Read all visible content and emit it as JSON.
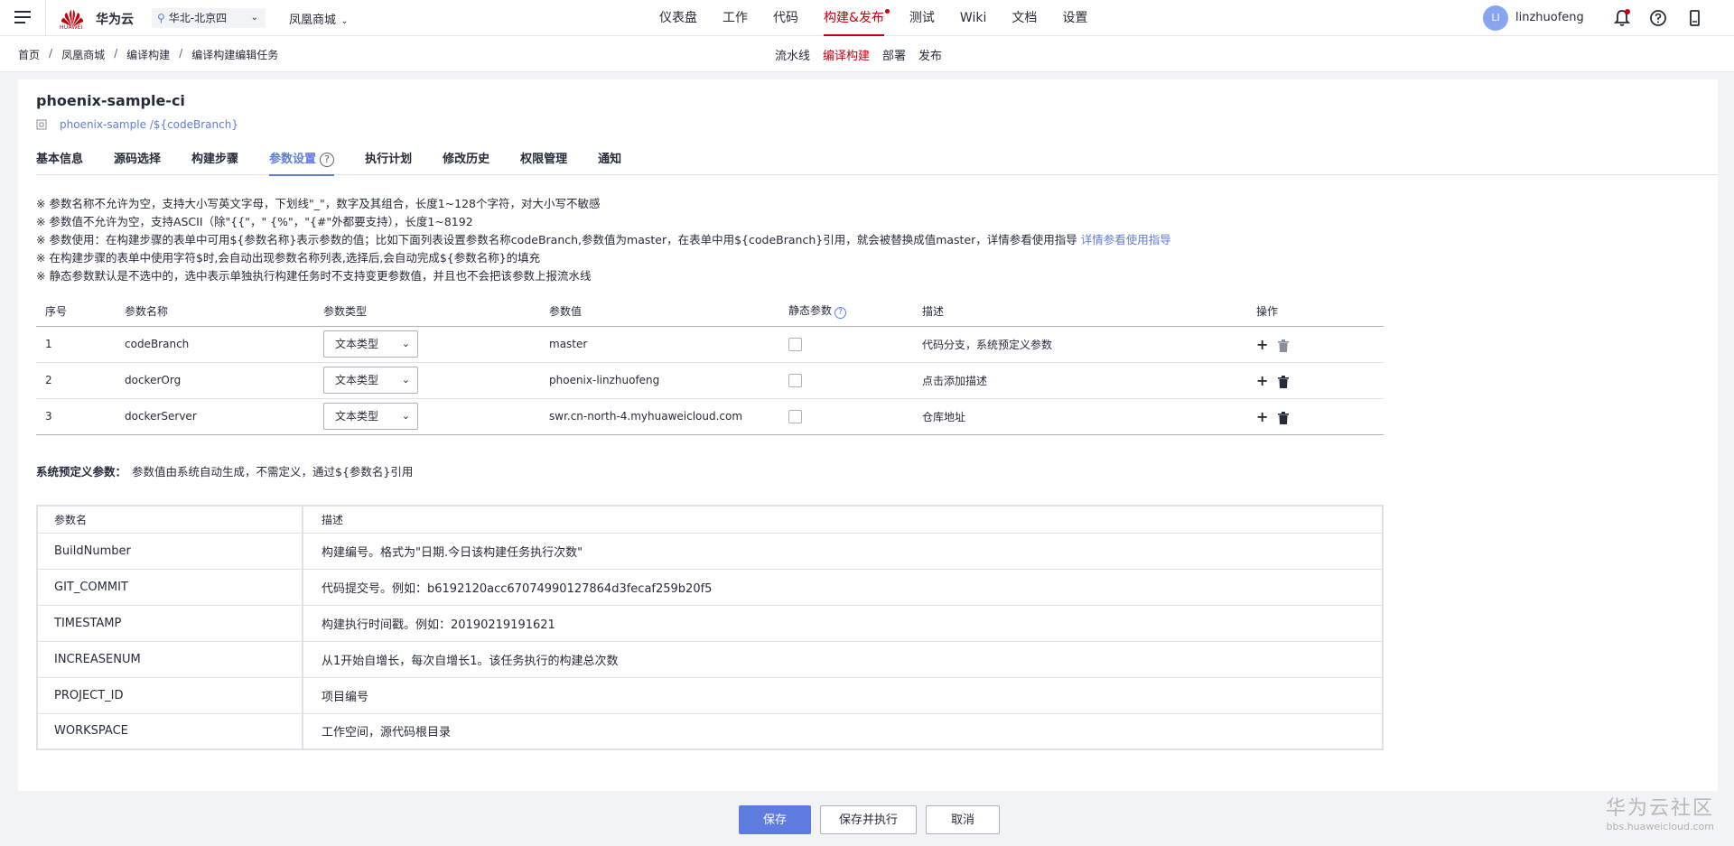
{
  "topbar": {
    "brand": "华为云",
    "logo_text": "HUAWEI",
    "region": "华北-北京四",
    "project": "凤凰商城",
    "nav": [
      "仪表盘",
      "工作",
      "代码",
      "构建&发布",
      "测试",
      "Wiki",
      "文档",
      "设置"
    ],
    "active_nav": "构建&发布",
    "avatar": "LI",
    "username": "linzhuofeng"
  },
  "subbar": {
    "breadcrumbs": [
      "首页",
      "凤凰商城",
      "编译构建",
      "编译构建编辑任务"
    ],
    "separator": "/",
    "nav": [
      "流水线",
      "编译构建",
      "部署",
      "发布"
    ],
    "active_nav": "编译构建"
  },
  "job": {
    "title": "phoenix-sample-ci",
    "repo": "phoenix-sample /${codeBranch}"
  },
  "tabs": [
    "基本信息",
    "源码选择",
    "构建步骤",
    "参数设置",
    "执行计划",
    "修改历史",
    "权限管理",
    "通知"
  ],
  "active_tab": "参数设置",
  "notes": {
    "n1": "※ 参数名称不允许为空，支持大小写英文字母，下划线\"_\"，数字及其组合，长度1~128个字符，对大小写不敏感",
    "n2": "※ 参数值不允许为空，支持ASCII（除\"{{\"，\" {%\"，\"{#\"外都要支持），长度1~8192",
    "n3": "※ 参数使用：在构建步骤的表单中可用${参数名称}表示参数的值；比如下面列表设置参数名称codeBranch,参数值为master，在表单中用${codeBranch}引用，就会被替换成值master，详情参看使用指导",
    "n3_link": "详情参看使用指导",
    "n4": "※ 在构建步骤的表单中使用字符$时,会自动出现参数名称列表,选择后,会自动完成${参数名称}的填充",
    "n5": "※ 静态参数默认是不选中的，选中表示单独执行构建任务时不支持变更参数值，并且也不会把该参数上报流水线"
  },
  "params": {
    "headers": [
      "序号",
      "参数名称",
      "参数类型",
      "参数值",
      "静态参数",
      "描述",
      "操作"
    ],
    "rows": [
      {
        "no": "1",
        "name": "codeBranch",
        "type": "文本类型",
        "value": "master",
        "desc": "代码分支，系统预定义参数"
      },
      {
        "no": "2",
        "name": "dockerOrg",
        "type": "文本类型",
        "value": "phoenix-linzhuofeng",
        "desc": "点击添加描述"
      },
      {
        "no": "3",
        "name": "dockerServer",
        "type": "文本类型",
        "value": "swr.cn-north-4.myhuaweicloud.com",
        "desc": "仓库地址"
      }
    ]
  },
  "sys": {
    "title": "系统预定义参数：",
    "subtitle": "参数值由系统自动生成，不需定义，通过${参数名}引用",
    "headers": [
      "参数名",
      "描述"
    ],
    "rows": [
      {
        "name": "BuildNumber",
        "desc": "构建编号。格式为\"日期.今日该构建任务执行次数\""
      },
      {
        "name": "GIT_COMMIT",
        "desc": "代码提交号。例如：b6192120acc67074990127864d3fecaf259b20f5"
      },
      {
        "name": "TIMESTAMP",
        "desc": "构建执行时间戳。例如：20190219191621"
      },
      {
        "name": "INCREASENUM",
        "desc": "从1开始自增长，每次自增长1。该任务执行的构建总次数"
      },
      {
        "name": "PROJECT_ID",
        "desc": "项目编号"
      },
      {
        "name": "WORKSPACE",
        "desc": "工作空间，源代码根目录"
      }
    ]
  },
  "footer": {
    "save": "保存",
    "save_run": "保存并执行",
    "cancel": "取消"
  },
  "watermark": {
    "line1": "华为云社区",
    "line2": "bbs.huaweicloud.com"
  },
  "colors": {
    "accent": "#5e7ce0",
    "brand": "#c7000b"
  }
}
